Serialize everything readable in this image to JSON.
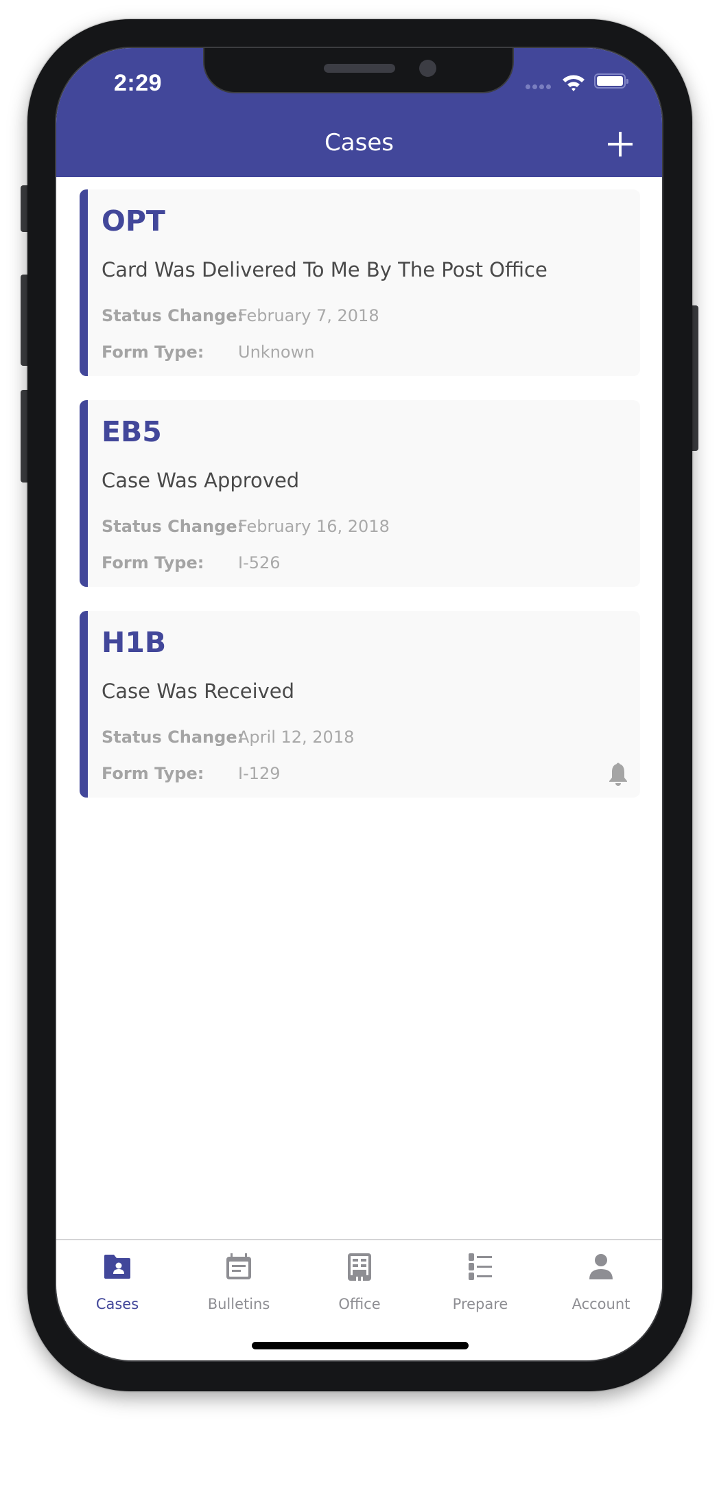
{
  "status_bar": {
    "time": "2:29",
    "icons": [
      "signal-icon",
      "wifi-icon",
      "battery-icon"
    ]
  },
  "nav": {
    "title": "Cases",
    "add_icon": "plus-icon"
  },
  "colors": {
    "brand": "#42479a",
    "card_background": "#f9f9f9",
    "label_gray": "#a4a4a4",
    "inactive_tab": "#8e8e93"
  },
  "field_labels": {
    "status_change": "Status Change:",
    "form_type": "Form Type:"
  },
  "cases": [
    {
      "title": "OPT",
      "status": "Card Was Delivered To Me By The Post Office",
      "status_change": "February 7, 2018",
      "form_type": "Unknown",
      "notification": false
    },
    {
      "title": "EB5",
      "status": "Case Was Approved",
      "status_change": "February 16, 2018",
      "form_type": "I-526",
      "notification": false
    },
    {
      "title": "H1B",
      "status": "Case Was Received",
      "status_change": "April 12, 2018",
      "form_type": "I-129",
      "notification": true
    }
  ],
  "tabs": [
    {
      "label": "Cases",
      "icon": "folder-user-icon",
      "active": true
    },
    {
      "label": "Bulletins",
      "icon": "calendar-icon",
      "active": false
    },
    {
      "label": "Office",
      "icon": "building-icon",
      "active": false
    },
    {
      "label": "Prepare",
      "icon": "list-icon",
      "active": false
    },
    {
      "label": "Account",
      "icon": "person-icon",
      "active": false
    }
  ]
}
